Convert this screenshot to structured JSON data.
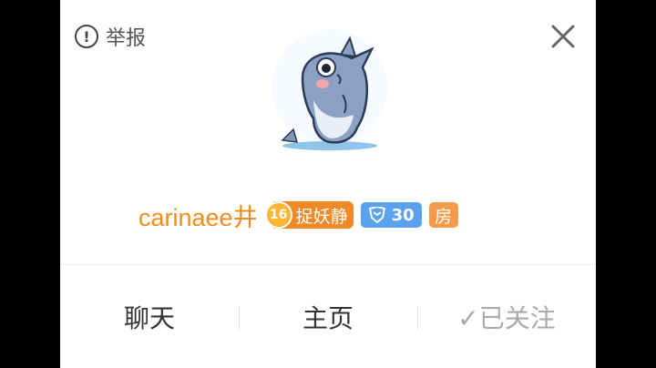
{
  "header": {
    "report_label": "举报",
    "report_icon": "exclamation-circle-icon",
    "close_icon": "close-x-icon"
  },
  "profile": {
    "avatar": "shark-cartoon-avatar",
    "username": "carinaee井",
    "fan_badge": {
      "level": "16",
      "name": "捉妖静"
    },
    "level_badge": {
      "value": "30"
    },
    "room_badge": "房"
  },
  "actions": [
    {
      "label": "聊天"
    },
    {
      "label": "主页"
    },
    {
      "label": "✓已关注"
    }
  ],
  "colors": {
    "accent": "#f08c1a",
    "level_badge": "#5aa1ee",
    "room_badge": "#f59a4a"
  }
}
